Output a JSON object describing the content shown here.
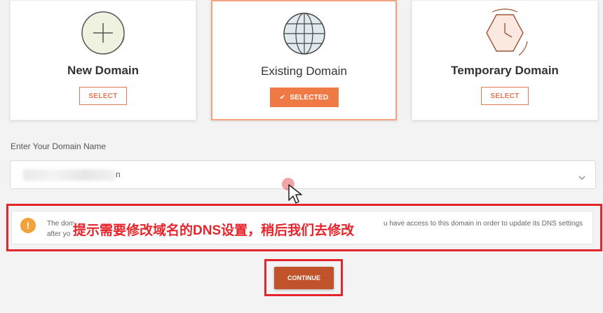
{
  "cards": [
    {
      "title": "New Domain",
      "button": "SELECT",
      "icon": "plus-circle-icon"
    },
    {
      "title": "Existing Domain",
      "button": "SELECTED",
      "icon": "globe-icon"
    },
    {
      "title": "Temporary Domain",
      "button": "SELECT",
      "icon": "clock-hexagon-icon"
    }
  ],
  "domain_field": {
    "label": "Enter Your Domain Name",
    "value": "n"
  },
  "notice": {
    "text_start": "The dom",
    "text_end": "u have access to this domain in order to update its DNS settings",
    "text_line2": "after yo",
    "overlay_annotation": "提示需要修改域名的DNS设置，稍后我们去修改"
  },
  "continue_label": "CONTINUE",
  "colors": {
    "accent": "#f07a45",
    "annotation_red": "#e5242b",
    "continue": "#c0532b"
  }
}
